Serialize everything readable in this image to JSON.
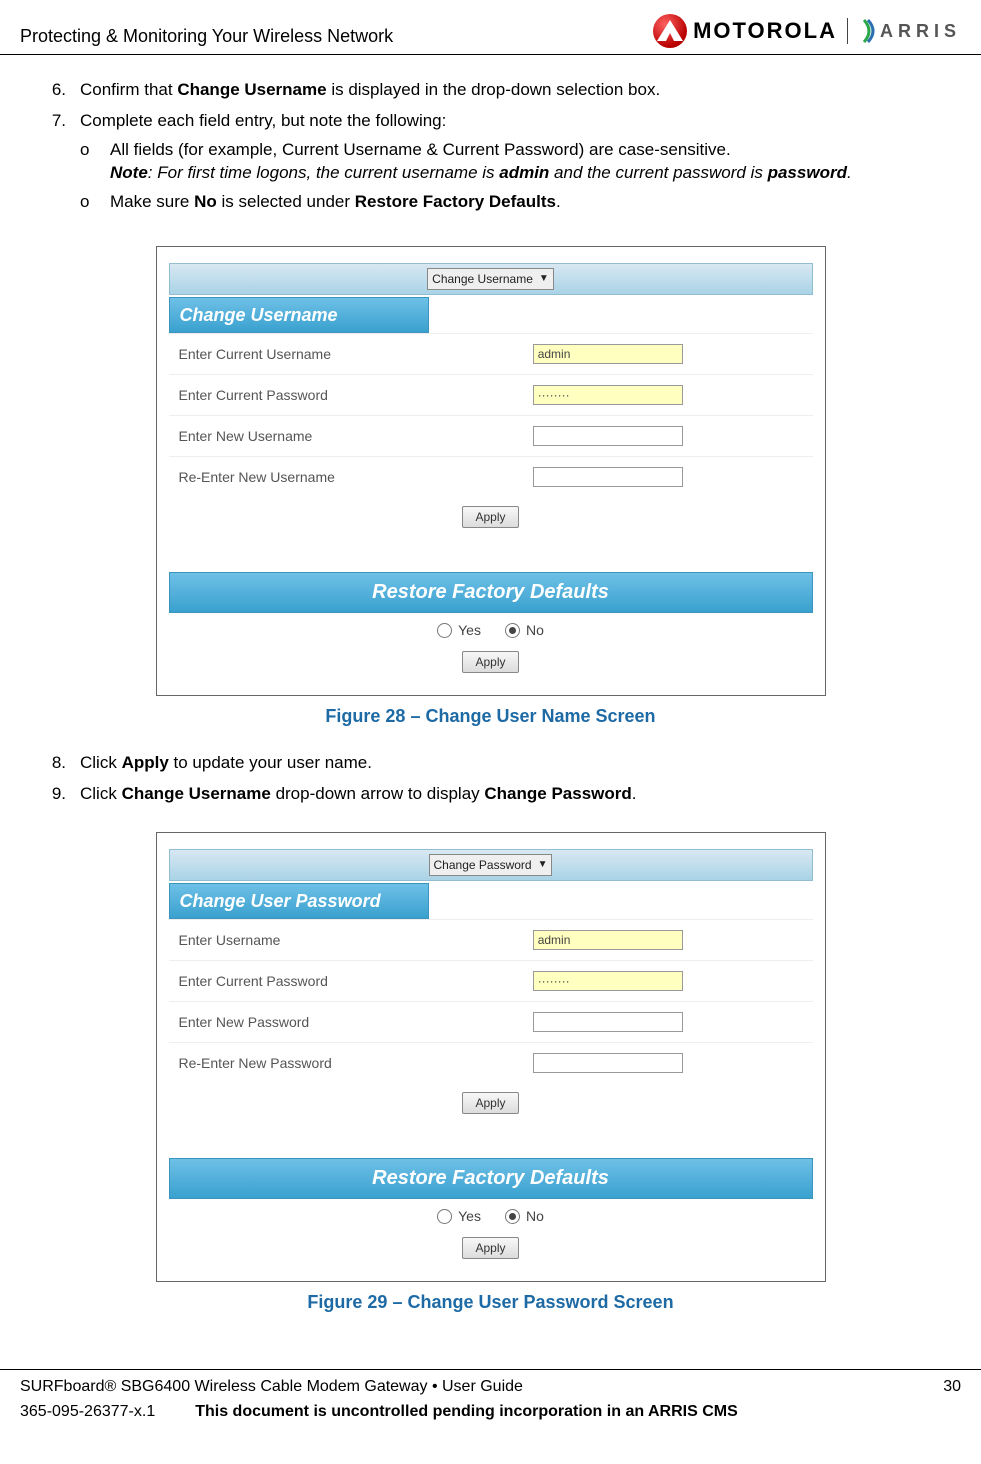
{
  "header": {
    "section_title": "Protecting & Monitoring Your Wireless Network",
    "motorola_word": "MOTOROLA",
    "arris_word": "ARRIS"
  },
  "steps": {
    "s6": {
      "num": "6.",
      "pre": "Confirm that ",
      "bold": "Change Username",
      "post": " is displayed in the drop-down selection box."
    },
    "s7": {
      "num": "7.",
      "lead": "Complete each field entry, but note the following:",
      "a": "All fields (for example, Current Username & Current Password) are case-sensitive.",
      "note_label": "Note",
      "note_pre": ": For first time logons, the current username is ",
      "note_b1": "admin",
      "note_mid": " and the current password is ",
      "note_b2": "password",
      "note_post": ".",
      "b_pre": "Make sure ",
      "b_b1": "No",
      "b_mid": " is selected under ",
      "b_b2": "Restore Factory Defaults",
      "b_post": "."
    },
    "s8": {
      "num": "8.",
      "pre": "Click ",
      "bold": "Apply",
      "post": " to update your user name."
    },
    "s9": {
      "num": "9.",
      "pre": "Click ",
      "b1": "Change Username",
      "mid": " drop-down arrow to display ",
      "b2": "Change Password",
      "post": "."
    }
  },
  "fig28": {
    "caption": "Figure 28 – Change User Name Screen",
    "dropdown": "Change Username",
    "header": "Change Username",
    "r1": "Enter Current Username",
    "r2": "Enter Current Password",
    "r3": "Enter New Username",
    "r4": "Re-Enter New Username",
    "v_user": "admin",
    "v_pass": "········",
    "apply": "Apply",
    "restore_header": "Restore Factory Defaults",
    "yes": "Yes",
    "no": "No"
  },
  "fig29": {
    "caption": "Figure 29 – Change User Password Screen",
    "dropdown": "Change Password",
    "header": "Change User Password",
    "r1": "Enter Username",
    "r2": "Enter Current Password",
    "r3": "Enter New Password",
    "r4": "Re-Enter New Password",
    "v_user": "admin",
    "v_pass": "········",
    "apply": "Apply",
    "restore_header": "Restore Factory Defaults",
    "yes": "Yes",
    "no": "No"
  },
  "footer": {
    "product": "SURFboard® SBG6400 Wireless Cable Modem Gateway • User Guide",
    "page_num": "30",
    "doc_id": "365-095-26377-x.1",
    "uncontrolled": "This document is uncontrolled pending incorporation in an ARRIS CMS"
  }
}
